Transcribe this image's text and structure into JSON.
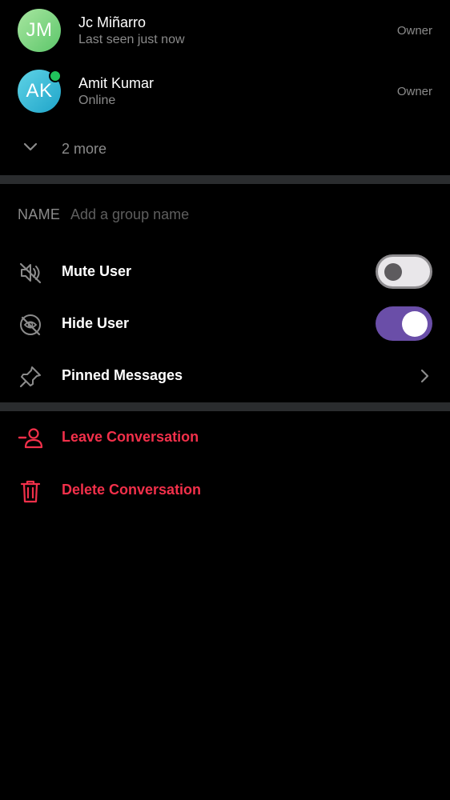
{
  "members": [
    {
      "initials": "JM",
      "name": "Jc Miñarro",
      "status": "Last seen just now",
      "role": "Owner",
      "avatar_color": "#7ed687",
      "online": false
    },
    {
      "initials": "AK",
      "name": "Amit Kumar",
      "status": "Online",
      "role": "Owner",
      "avatar_color": "#3ab9d9",
      "online": true
    }
  ],
  "more": {
    "label": "2 more",
    "icon": "chevron-down-icon"
  },
  "name_field": {
    "label": "NAME",
    "placeholder": "Add a group name",
    "value": ""
  },
  "options": {
    "mute": {
      "label": "Mute User",
      "icon": "speaker-muted-icon",
      "enabled": false
    },
    "hide": {
      "label": "Hide User",
      "icon": "eye-off-icon",
      "enabled": true
    },
    "pinned": {
      "label": "Pinned Messages",
      "icon": "pin-icon"
    }
  },
  "actions": {
    "leave": {
      "label": "Leave Conversation",
      "icon": "remove-person-icon"
    },
    "delete": {
      "label": "Delete Conversation",
      "icon": "trash-icon"
    }
  },
  "colors": {
    "background": "#000000",
    "muted_text": "#8b8b8b",
    "divider": "#2a2c2e",
    "toggle_on": "#6a4ea8",
    "danger": "#f2304a",
    "online_indicator": "#21c35b"
  }
}
